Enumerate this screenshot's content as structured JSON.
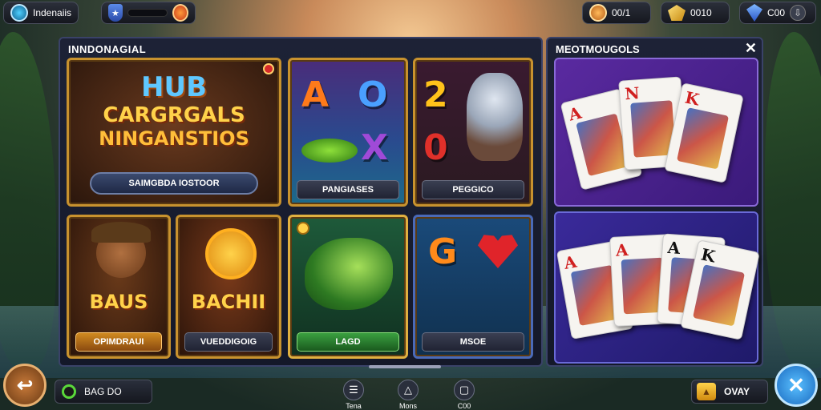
{
  "topbar": {
    "player_name": "Indenaiis",
    "coins": "00/1",
    "gold": "0010",
    "gems": "C00"
  },
  "panel": {
    "title": "INNDONAGIAL"
  },
  "tiles": {
    "hub": {
      "logo_line1": "HUB",
      "logo_line2": "CARGRGALS",
      "logo_line3": "NINGANSTIOS",
      "button": "SAIMGBDA IOSTOOR"
    },
    "letters": {
      "label": "PANGIASES",
      "glyphs": [
        "A",
        "O",
        "X"
      ]
    },
    "numbers": {
      "label": "PEGGICO",
      "glyphs": [
        "2",
        "0"
      ]
    },
    "bear": {
      "word": "BAUS",
      "label": "OPIMDRAUI"
    },
    "sun": {
      "word": "BACHII",
      "label": "VUEDDIGOIG"
    },
    "fish": {
      "label": "LAGD"
    },
    "mixed": {
      "label": "MSOE",
      "glyph": "G"
    }
  },
  "right_panel": {
    "title": "MEOTMOUGOLS"
  },
  "cards_top": [
    "A",
    "N",
    "K"
  ],
  "cards_bottom": [
    "A",
    "A",
    "A",
    "K"
  ],
  "bottombar": {
    "search_label": "BAG DO",
    "nav": [
      {
        "label": "Tena",
        "icon": "list-icon"
      },
      {
        "label": "Mons",
        "icon": "triangle-icon"
      },
      {
        "label": "C00",
        "icon": "box-icon"
      }
    ],
    "play_label": "OVAY"
  },
  "icons": {
    "back": "↩",
    "close": "✕",
    "panel_close": "✕"
  }
}
